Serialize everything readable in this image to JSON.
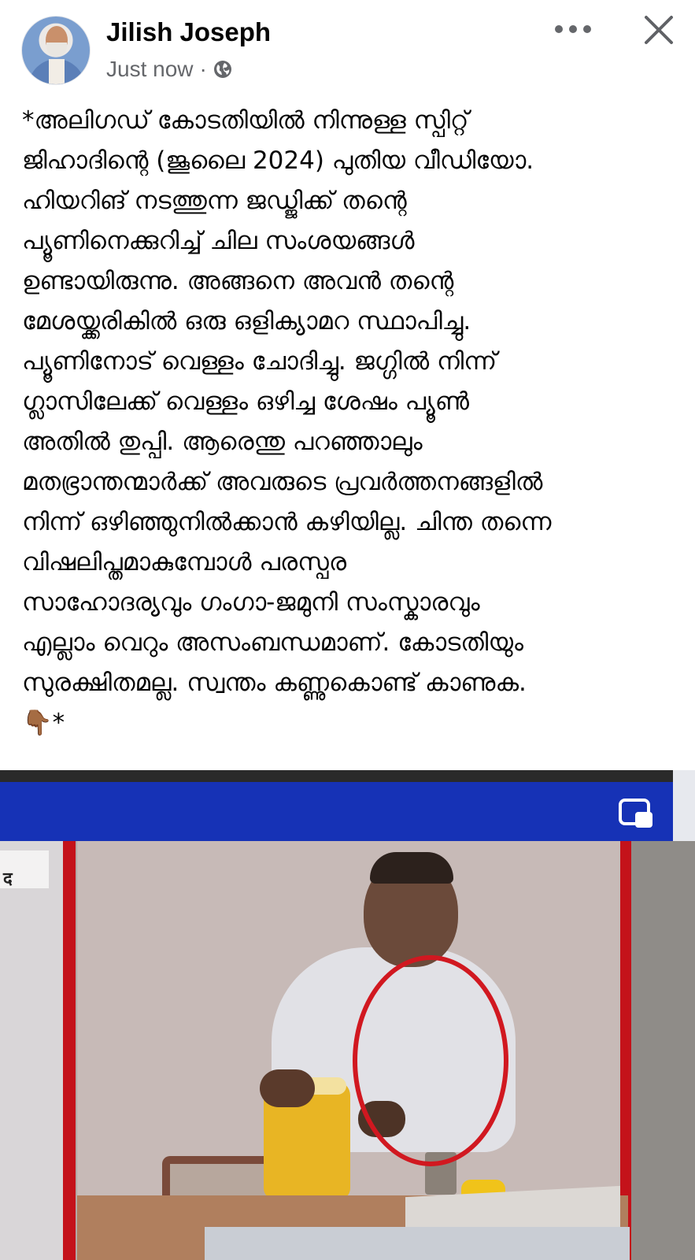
{
  "post": {
    "author": "Jilish Joseph",
    "time": "Just now",
    "separator": "·",
    "privacy_icon": "globe-icon",
    "text_lines": [
      "*അലിഗഡ് കോടതിയിൽ നിന്നുള്ള സ്പിറ്റ്",
      "ജിഹാദിന്റെ (ജൂലൈ 2024) പുതിയ വീഡിയോ.",
      "ഹിയറിങ് നടത്തുന്ന ജഡ്ജിക്ക് തന്റെ",
      "പ്യൂണിനെക്കുറിച്ച് ചില സംശയങ്ങൾ",
      "ഉണ്ടായിരുന്നു.  അങ്ങനെ അവൻ തന്റെ",
      "മേശയ്ക്കരികിൽ ഒരു ഒളിക്യാമറ സ്ഥാപിച്ചു.",
      "പ്യൂണിനോട് വെള്ളം ചോദിച്ചു.  ജഗ്ഗിൽ നിന്ന്",
      "ഗ്ലാസിലേക്ക് വെള്ളം ഒഴിച്ച ശേഷം പ്യൂൺ",
      "അതിൽ തുപ്പി.  ആരെന്തു പറഞ്ഞാലും",
      "മതഭ്രാന്തന്മാർക്ക് അവരുടെ പ്രവർത്തനങ്ങളിൽ",
      "നിന്ന് ഒഴിഞ്ഞുനിൽക്കാൻ കഴിയില്ല.  ചിന്ത തന്നെ",
      "വിഷലിപ്തമാകുമ്പോൾ പരസ്പര",
      "സാഹോദര്യവും ഗംഗാ-ജമുനി സംസ്കാരവും",
      "എല്ലാം വെറും അസംബന്ധമാണ്.  കോടതിയും",
      "സുരക്ഷിതമല്ല.  സ്വന്തം കണ്ണുകൊണ്ട് കാണുക.",
      "👇🏾*"
    ]
  },
  "media": {
    "sign_text": "द",
    "pip_icon": "picture-in-picture-icon",
    "banner_color": "#1632b6",
    "highlight_color": "#d11820"
  },
  "icons": {
    "more": "more-options-icon",
    "close": "close-icon"
  }
}
